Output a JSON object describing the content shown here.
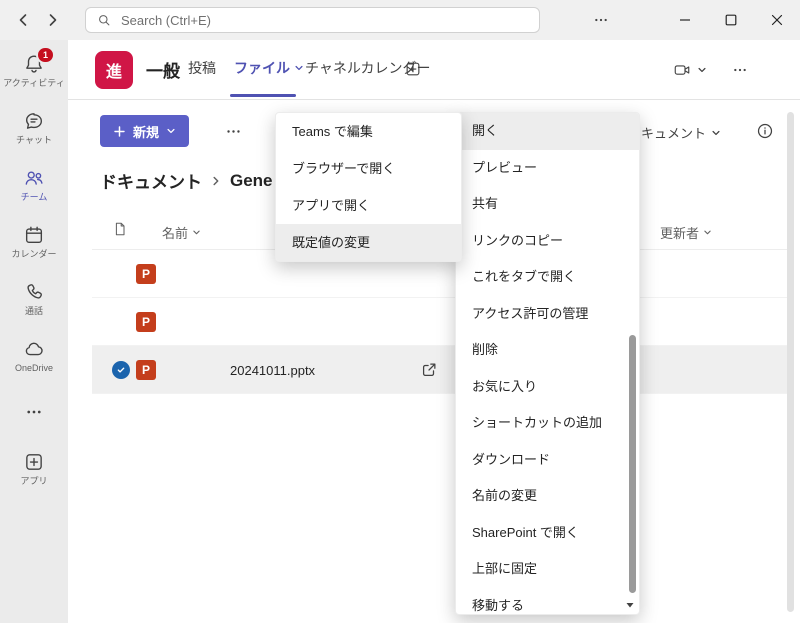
{
  "titlebar": {
    "search_placeholder": "Search (Ctrl+E)"
  },
  "sidebar": {
    "activity": "アクティビティ",
    "activity_badge": "1",
    "chat": "チャット",
    "teams": "チーム",
    "calendar": "カレンダー",
    "calls": "通話",
    "onedrive": "OneDrive",
    "apps": "アプリ"
  },
  "channel": {
    "avatar": "進",
    "title": "一般",
    "tab_posts": "投稿",
    "tab_files": "ファイル",
    "tab_calendar": "チャネルカレンダー"
  },
  "toolbar": {
    "new_label": "新規",
    "documents_dropdown": "キュメント"
  },
  "breadcrumb": {
    "root": "ドキュメント",
    "current": "Gene"
  },
  "files": {
    "col_name": "名前",
    "col_modified_by": "更新者",
    "ppt_letter": "P",
    "rows": [
      {
        "type": "PowerPoint"
      },
      {
        "type": "PowerPoint"
      },
      {
        "type": "PowerPoint",
        "name": "20241011.pptx",
        "selected": true
      }
    ]
  },
  "open_submenu": {
    "items": [
      "Teams で編集",
      "ブラウザーで開く",
      "アプリで開く",
      "既定値の変更"
    ],
    "highlighted": "既定値の変更"
  },
  "context_menu": {
    "items": [
      "開く",
      "プレビュー",
      "共有",
      "リンクのコピー",
      "これをタブで開く",
      "アクセス許可の管理",
      "削除",
      "お気に入り",
      "ショートカットの追加",
      "ダウンロード",
      "名前の変更",
      "SharePoint で開く",
      "上部に固定",
      "移動する"
    ],
    "highlighted": "開く"
  },
  "colors": {
    "accent_purple": "#5b5fc7",
    "active_purple": "#4f52b2",
    "avatar_red": "#d01646",
    "badge_red": "#c50f1f",
    "ppt_red": "#c43e1c",
    "check_blue": "#1b64ad",
    "menu_highlight": "#ededed"
  }
}
